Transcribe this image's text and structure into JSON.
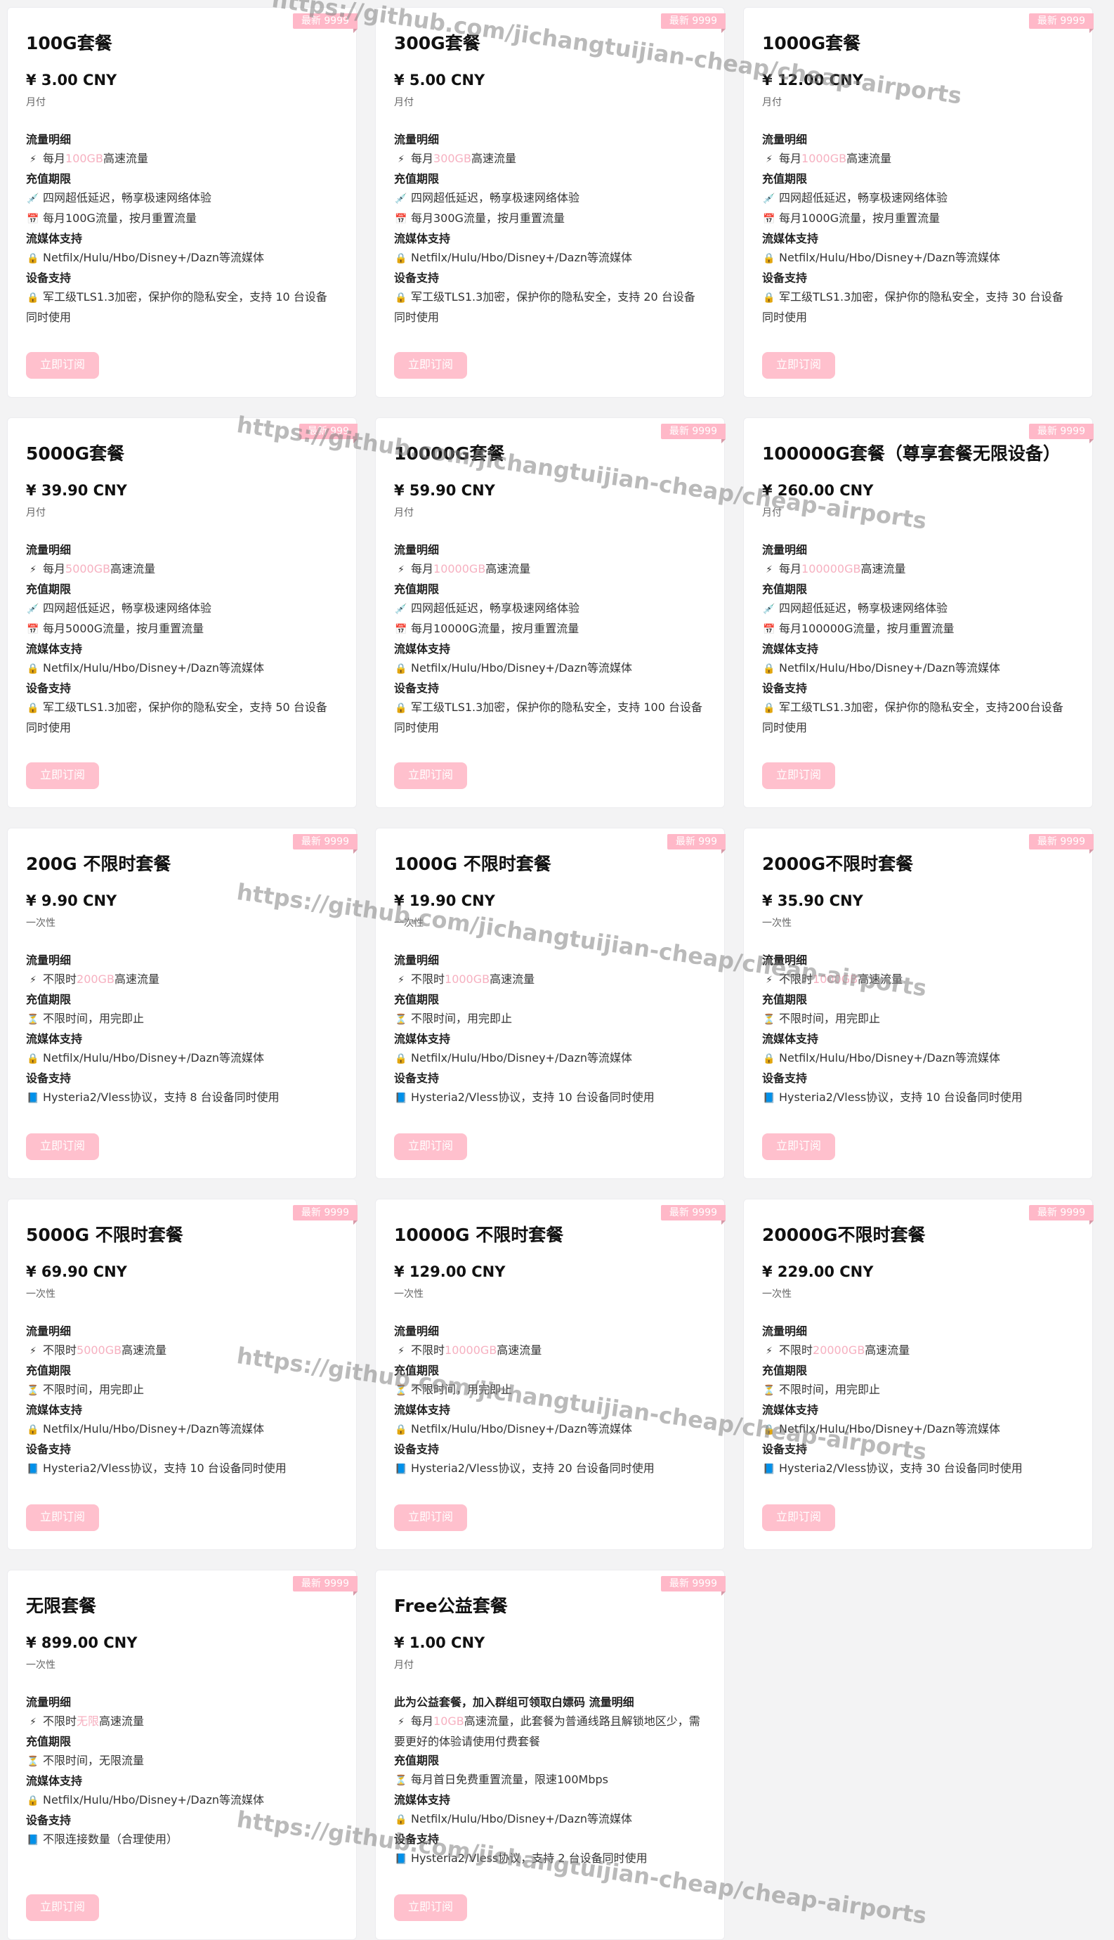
{
  "plans": [
    {
      "badge": "最新 9999",
      "title": "100G套餐",
      "price": "¥ 3.00 CNY",
      "period": "月付",
      "sections": [
        {
          "head": "流量明细",
          "lines": [
            {
              "icon": "⚡",
              "pre": "每月",
              "faint": "100GB",
              "post": "高速流量"
            }
          ]
        },
        {
          "head": "充值期限",
          "lines": [
            {
              "icon": "💉",
              "text": "四网超低延迟，畅享极速网络体验"
            },
            {
              "icon": "📅",
              "text": "每月100G流量，按月重置流量"
            }
          ]
        },
        {
          "head": "流媒体支持",
          "lines": [
            {
              "icon": "🔒",
              "text": "Netfilx/Hulu/Hbo/Disney+/Dazn等流媒体"
            }
          ]
        },
        {
          "head": "设备支持",
          "lines": [
            {
              "icon": "🔒",
              "text": "军工级TLS1.3加密，保护你的隐私安全，支持 10 台设备同时使用"
            }
          ]
        }
      ],
      "button": "立即订阅"
    },
    {
      "badge": "最新 9999",
      "title": "300G套餐",
      "price": "¥ 5.00 CNY",
      "period": "月付",
      "sections": [
        {
          "head": "流量明细",
          "lines": [
            {
              "icon": "⚡",
              "pre": "每月",
              "faint": "300GB",
              "post": "高速流量"
            }
          ]
        },
        {
          "head": "充值期限",
          "lines": [
            {
              "icon": "💉",
              "text": "四网超低延迟，畅享极速网络体验"
            },
            {
              "icon": "📅",
              "text": "每月300G流量，按月重置流量"
            }
          ]
        },
        {
          "head": "流媒体支持",
          "lines": [
            {
              "icon": "🔒",
              "text": "Netfilx/Hulu/Hbo/Disney+/Dazn等流媒体"
            }
          ]
        },
        {
          "head": "设备支持",
          "lines": [
            {
              "icon": "🔒",
              "text": "军工级TLS1.3加密，保护你的隐私安全，支持 20 台设备同时使用"
            }
          ]
        }
      ],
      "button": "立即订阅"
    },
    {
      "badge": "最新 9999",
      "title": "1000G套餐",
      "price": "¥ 12.00 CNY",
      "period": "月付",
      "sections": [
        {
          "head": "流量明细",
          "lines": [
            {
              "icon": "⚡",
              "pre": "每月",
              "faint": "1000GB",
              "post": "高速流量"
            }
          ]
        },
        {
          "head": "充值期限",
          "lines": [
            {
              "icon": "💉",
              "text": "四网超低延迟，畅享极速网络体验"
            },
            {
              "icon": "📅",
              "text": "每月1000G流量，按月重置流量"
            }
          ]
        },
        {
          "head": "流媒体支持",
          "lines": [
            {
              "icon": "🔒",
              "text": "Netfilx/Hulu/Hbo/Disney+/Dazn等流媒体"
            }
          ]
        },
        {
          "head": "设备支持",
          "lines": [
            {
              "icon": "🔒",
              "text": "军工级TLS1.3加密，保护你的隐私安全，支持 30 台设备同时使用"
            }
          ]
        }
      ],
      "button": "立即订阅"
    },
    {
      "badge": "最新 999",
      "title": "5000G套餐",
      "price": "¥ 39.90 CNY",
      "period": "月付",
      "sections": [
        {
          "head": "流量明细",
          "lines": [
            {
              "icon": "⚡",
              "pre": "每月",
              "faint": "5000GB",
              "post": "高速流量"
            }
          ]
        },
        {
          "head": "充值期限",
          "lines": [
            {
              "icon": "💉",
              "text": "四网超低延迟，畅享极速网络体验"
            },
            {
              "icon": "📅",
              "text": "每月5000G流量，按月重置流量"
            }
          ]
        },
        {
          "head": "流媒体支持",
          "lines": [
            {
              "icon": "🔒",
              "text": "Netfilx/Hulu/Hbo/Disney+/Dazn等流媒体"
            }
          ]
        },
        {
          "head": "设备支持",
          "lines": [
            {
              "icon": "🔒",
              "text": "军工级TLS1.3加密，保护你的隐私安全，支持 50 台设备同时使用"
            }
          ]
        }
      ],
      "button": "立即订阅"
    },
    {
      "badge": "最新 9999",
      "title": "10000G套餐",
      "price": "¥ 59.90 CNY",
      "period": "月付",
      "sections": [
        {
          "head": "流量明细",
          "lines": [
            {
              "icon": "⚡",
              "pre": "每月",
              "faint": "10000GB",
              "post": "高速流量"
            }
          ]
        },
        {
          "head": "充值期限",
          "lines": [
            {
              "icon": "💉",
              "text": "四网超低延迟，畅享极速网络体验"
            },
            {
              "icon": "📅",
              "text": "每月10000G流量，按月重置流量"
            }
          ]
        },
        {
          "head": "流媒体支持",
          "lines": [
            {
              "icon": "🔒",
              "text": "Netfilx/Hulu/Hbo/Disney+/Dazn等流媒体"
            }
          ]
        },
        {
          "head": "设备支持",
          "lines": [
            {
              "icon": "🔒",
              "text": "军工级TLS1.3加密，保护你的隐私安全，支持 100 台设备同时使用"
            }
          ]
        }
      ],
      "button": "立即订阅"
    },
    {
      "badge": "最新 9999",
      "title": "100000G套餐（尊享套餐无限设备）",
      "price": "¥ 260.00 CNY",
      "period": "月付",
      "sections": [
        {
          "head": "流量明细",
          "lines": [
            {
              "icon": "⚡",
              "pre": "每月",
              "faint": "100000GB",
              "post": "高速流量"
            }
          ]
        },
        {
          "head": "充值期限",
          "lines": [
            {
              "icon": "💉",
              "text": "四网超低延迟，畅享极速网络体验"
            },
            {
              "icon": "📅",
              "text": "每月100000G流量，按月重置流量"
            }
          ]
        },
        {
          "head": "流媒体支持",
          "lines": [
            {
              "icon": "🔒",
              "text": "Netfilx/Hulu/Hbo/Disney+/Dazn等流媒体"
            }
          ]
        },
        {
          "head": "设备支持",
          "lines": [
            {
              "icon": "🔒",
              "text": "军工级TLS1.3加密，保护你的隐私安全，支持200台设备同时使用"
            }
          ]
        }
      ],
      "button": "立即订阅"
    },
    {
      "badge": "最新 9999",
      "title": "200G 不限时套餐",
      "price": "¥ 9.90 CNY",
      "period": "一次性",
      "sections": [
        {
          "head": "流量明细",
          "lines": [
            {
              "icon": "⚡",
              "pre": "不限时",
              "faint": "200GB",
              "post": "高速流量"
            }
          ]
        },
        {
          "head": "充值期限",
          "lines": [
            {
              "icon": "⏳",
              "text": "不限时间，用完即止"
            }
          ]
        },
        {
          "head": "流媒体支持",
          "lines": [
            {
              "icon": "🔒",
              "text": "Netfilx/Hulu/Hbo/Disney+/Dazn等流媒体"
            }
          ]
        },
        {
          "head": "设备支持",
          "lines": [
            {
              "icon": "📘",
              "text": "Hysteria2/Vless协议，支持 8 台设备同时使用"
            }
          ]
        }
      ],
      "button": "立即订阅"
    },
    {
      "badge": "最新 999",
      "title": "1000G 不限时套餐",
      "price": "¥ 19.90 CNY",
      "period": "一次性",
      "sections": [
        {
          "head": "流量明细",
          "lines": [
            {
              "icon": "⚡",
              "pre": "不限时",
              "faint": "1000GB",
              "post": "高速流量"
            }
          ]
        },
        {
          "head": "充值期限",
          "lines": [
            {
              "icon": "⏳",
              "text": "不限时间，用完即止"
            }
          ]
        },
        {
          "head": "流媒体支持",
          "lines": [
            {
              "icon": "🔒",
              "text": "Netfilx/Hulu/Hbo/Disney+/Dazn等流媒体"
            }
          ]
        },
        {
          "head": "设备支持",
          "lines": [
            {
              "icon": "📘",
              "text": "Hysteria2/Vless协议，支持 10 台设备同时使用"
            }
          ]
        }
      ],
      "button": "立即订阅"
    },
    {
      "badge": "最新 9999",
      "title": "2000G不限时套餐",
      "price": "¥ 35.90 CNY",
      "period": "一次性",
      "sections": [
        {
          "head": "流量明细",
          "lines": [
            {
              "icon": "⚡",
              "pre": "不限时",
              "faint": "1000GB",
              "post": "高速流量"
            }
          ]
        },
        {
          "head": "充值期限",
          "lines": [
            {
              "icon": "⏳",
              "text": "不限时间，用完即止"
            }
          ]
        },
        {
          "head": "流媒体支持",
          "lines": [
            {
              "icon": "🔒",
              "text": "Netfilx/Hulu/Hbo/Disney+/Dazn等流媒体"
            }
          ]
        },
        {
          "head": "设备支持",
          "lines": [
            {
              "icon": "📘",
              "text": "Hysteria2/Vless协议，支持 10 台设备同时使用"
            }
          ]
        }
      ],
      "button": "立即订阅"
    },
    {
      "badge": "最新 9999",
      "title": "5000G 不限时套餐",
      "price": "¥ 69.90 CNY",
      "period": "一次性",
      "sections": [
        {
          "head": "流量明细",
          "lines": [
            {
              "icon": "⚡",
              "pre": "不限时",
              "faint": "5000GB",
              "post": "高速流量"
            }
          ]
        },
        {
          "head": "充值期限",
          "lines": [
            {
              "icon": "⏳",
              "text": "不限时间，用完即止"
            }
          ]
        },
        {
          "head": "流媒体支持",
          "lines": [
            {
              "icon": "🔒",
              "text": "Netfilx/Hulu/Hbo/Disney+/Dazn等流媒体"
            }
          ]
        },
        {
          "head": "设备支持",
          "lines": [
            {
              "icon": "📘",
              "text": "Hysteria2/Vless协议，支持 10 台设备同时使用"
            }
          ]
        }
      ],
      "button": "立即订阅"
    },
    {
      "badge": "最新 9999",
      "title": "10000G 不限时套餐",
      "price": "¥ 129.00 CNY",
      "period": "一次性",
      "sections": [
        {
          "head": "流量明细",
          "lines": [
            {
              "icon": "⚡",
              "pre": "不限时",
              "faint": "10000GB",
              "post": "高速流量"
            }
          ]
        },
        {
          "head": "充值期限",
          "lines": [
            {
              "icon": "⏳",
              "text": "不限时间，用完即止"
            }
          ]
        },
        {
          "head": "流媒体支持",
          "lines": [
            {
              "icon": "🔒",
              "text": "Netfilx/Hulu/Hbo/Disney+/Dazn等流媒体"
            }
          ]
        },
        {
          "head": "设备支持",
          "lines": [
            {
              "icon": "📘",
              "text": "Hysteria2/Vless协议，支持 20 台设备同时使用"
            }
          ]
        }
      ],
      "button": "立即订阅"
    },
    {
      "badge": "最新 9999",
      "title": "20000G不限时套餐",
      "price": "¥ 229.00 CNY",
      "period": "一次性",
      "sections": [
        {
          "head": "流量明细",
          "lines": [
            {
              "icon": "⚡",
              "pre": "不限时",
              "faint": "20000GB",
              "post": "高速流量"
            }
          ]
        },
        {
          "head": "充值期限",
          "lines": [
            {
              "icon": "⏳",
              "text": "不限时间，用完即止"
            }
          ]
        },
        {
          "head": "流媒体支持",
          "lines": [
            {
              "icon": "🔒",
              "text": "Netfilx/Hulu/Hbo/Disney+/Dazn等流媒体"
            }
          ]
        },
        {
          "head": "设备支持",
          "lines": [
            {
              "icon": "📘",
              "text": "Hysteria2/Vless协议，支持 30 台设备同时使用"
            }
          ]
        }
      ],
      "button": "立即订阅"
    },
    {
      "badge": "最新 9999",
      "title": "无限套餐",
      "price": "¥ 899.00 CNY",
      "period": "一次性",
      "sections": [
        {
          "head": "流量明细",
          "lines": [
            {
              "icon": "⚡",
              "pre": "不限时",
              "faint": "无限",
              "post": "高速流量"
            }
          ]
        },
        {
          "head": "充值期限",
          "lines": [
            {
              "icon": "⏳",
              "text": "不限时间，无限流量"
            }
          ]
        },
        {
          "head": "流媒体支持",
          "lines": [
            {
              "icon": "🔒",
              "text": "Netfilx/Hulu/Hbo/Disney+/Dazn等流媒体"
            }
          ]
        },
        {
          "head": "设备支持",
          "lines": [
            {
              "icon": "📘",
              "text": "不限连接数量（合理使用）"
            }
          ]
        }
      ],
      "button": "立即订阅"
    },
    {
      "badge": "最新 9999",
      "title": "Free公益套餐",
      "price": "¥ 1.00 CNY",
      "period": "月付",
      "sections": [
        {
          "head": "此为公益套餐，加入群组可领取白嫖码 流量明细",
          "lines": [
            {
              "icon": "⚡",
              "pre": "每月",
              "faint": "10GB",
              "post": "高速流量，此套餐为普通线路且解锁地区少，需要更好的体验请使用付费套餐"
            }
          ]
        },
        {
          "head": "充值期限",
          "lines": [
            {
              "icon": "⏳",
              "text": "每月首日免费重置流量，限速100Mbps"
            }
          ]
        },
        {
          "head": "流媒体支持",
          "lines": [
            {
              "icon": "🔒",
              "text": "Netfilx/Hulu/Hbo/Disney+/Dazn等流媒体"
            }
          ]
        },
        {
          "head": "设备支持",
          "lines": [
            {
              "icon": "📘",
              "text": "Hysteria2/Vless协议，支持 2 台设备同时使用"
            }
          ]
        }
      ],
      "button": "立即订阅"
    }
  ],
  "watermark": "https://github.com/jichangtuijian-cheap/cheap-airports"
}
